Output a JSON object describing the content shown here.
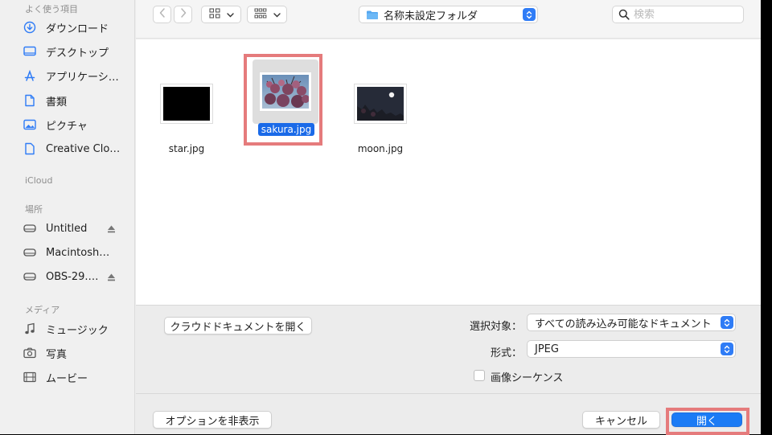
{
  "sidebar": {
    "favorites_header": "よく使う項目",
    "favorites": [
      {
        "label": "ダウンロード",
        "icon": "download-icon"
      },
      {
        "label": "デスクトップ",
        "icon": "desktop-icon"
      },
      {
        "label": "アプリケーシ…",
        "icon": "applications-icon"
      },
      {
        "label": "書類",
        "icon": "document-icon"
      },
      {
        "label": "ピクチャ",
        "icon": "pictures-icon"
      },
      {
        "label": "Creative Clo…",
        "icon": "file-icon"
      }
    ],
    "icloud_header": "iCloud",
    "locations_header": "場所",
    "locations": [
      {
        "label": "Untitled",
        "icon": "drive-icon",
        "eject": true
      },
      {
        "label": "Macintosh…",
        "icon": "drive-icon",
        "eject": false
      },
      {
        "label": "OBS-29.…",
        "icon": "drive-icon",
        "eject": true
      }
    ],
    "media_header": "メディア",
    "media": [
      {
        "label": "ミュージック",
        "icon": "music-icon"
      },
      {
        "label": "写真",
        "icon": "camera-icon"
      },
      {
        "label": "ムービー",
        "icon": "film-icon"
      }
    ]
  },
  "toolbar": {
    "path": "名称未設定フォルダ",
    "search_placeholder": "検索"
  },
  "files": [
    {
      "name": "star.jpg",
      "selected": false
    },
    {
      "name": "sakura.jpg",
      "selected": true
    },
    {
      "name": "moon.jpg",
      "selected": false
    }
  ],
  "options": {
    "cloud_button": "クラウドドキュメントを開く",
    "enable_label": "選択対象：",
    "enable_value": "すべての読み込み可能なドキュメント",
    "format_label": "形式：",
    "format_value": "JPEG",
    "sequence_label": "画像シーケンス",
    "sequence_checked": false
  },
  "footer": {
    "hide_options": "オプションを非表示",
    "cancel": "キャンセル",
    "open": "開く"
  },
  "colors": {
    "accent": "#1b7bf5",
    "highlight": "#e57b7c",
    "folder": "#55a7f0"
  }
}
